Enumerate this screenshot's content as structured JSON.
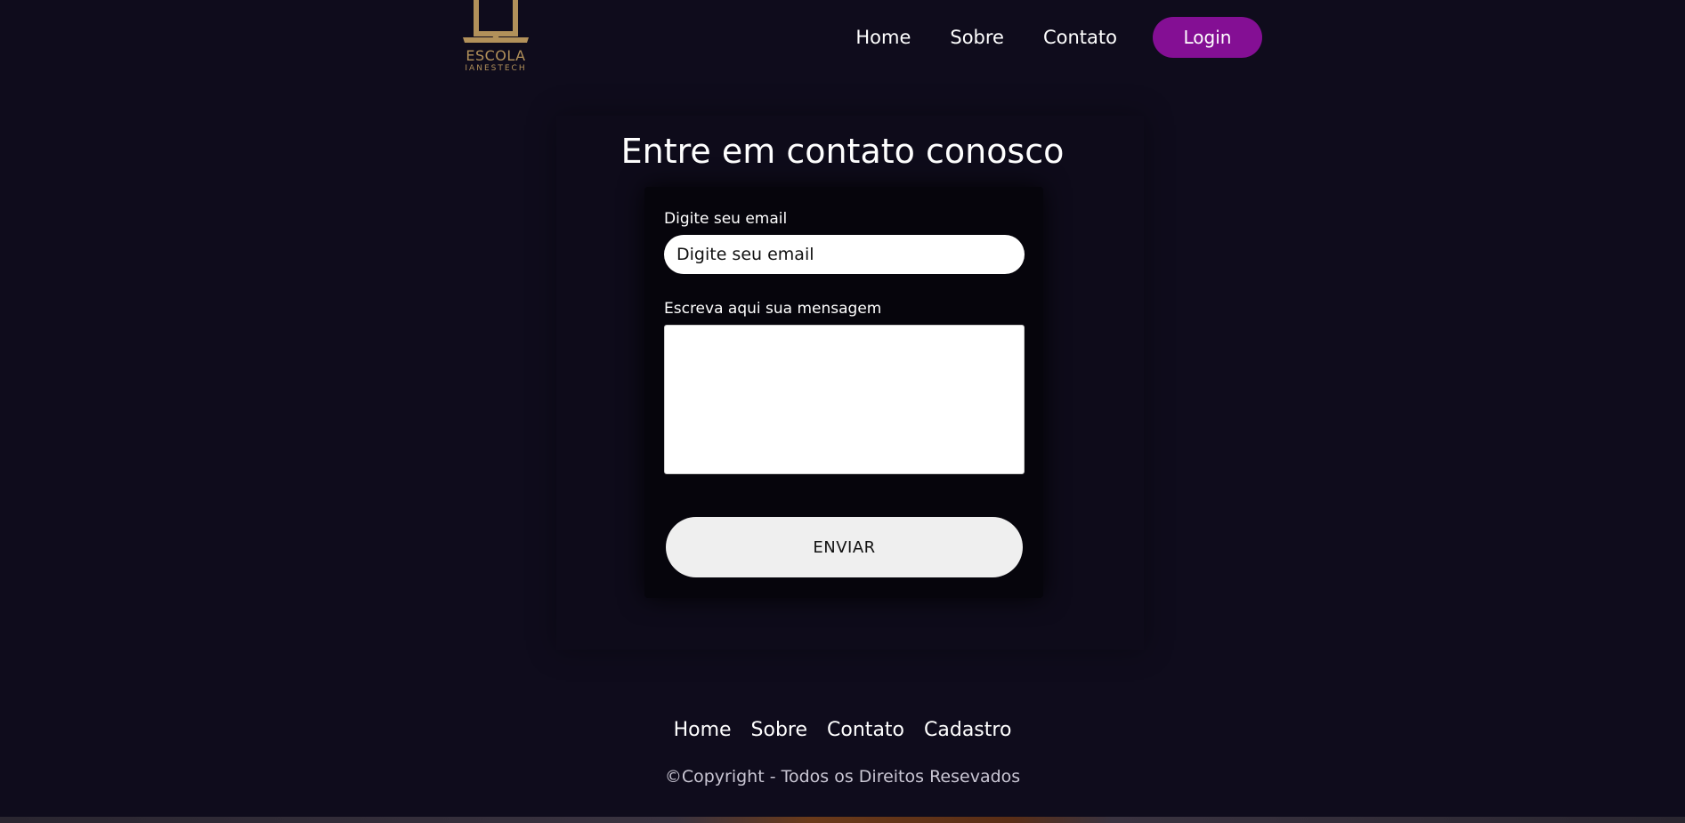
{
  "logo": {
    "icon": "laptop-icon",
    "title": "ESCOLA",
    "subtitle": "IANESTECH",
    "color": "#b2915a"
  },
  "header": {
    "nav": [
      "Home",
      "Sobre",
      "Contato"
    ],
    "login_label": "Login",
    "login_color": "#840f94"
  },
  "contact": {
    "title": "Entre em contato conosco",
    "email_label": "Digite seu email",
    "email_placeholder": "Digite seu email",
    "email_value": "",
    "message_label": "Escreva aqui sua mensagem",
    "message_value": "",
    "submit_label": "ENVIAR"
  },
  "footer": {
    "links": [
      "Home",
      "Sobre",
      "Contato",
      "Cadastro"
    ],
    "copyright": "©Copyright - Todos os Direitos Resevados"
  },
  "colors": {
    "background": "#0f0c1c",
    "card": "#06050c"
  }
}
